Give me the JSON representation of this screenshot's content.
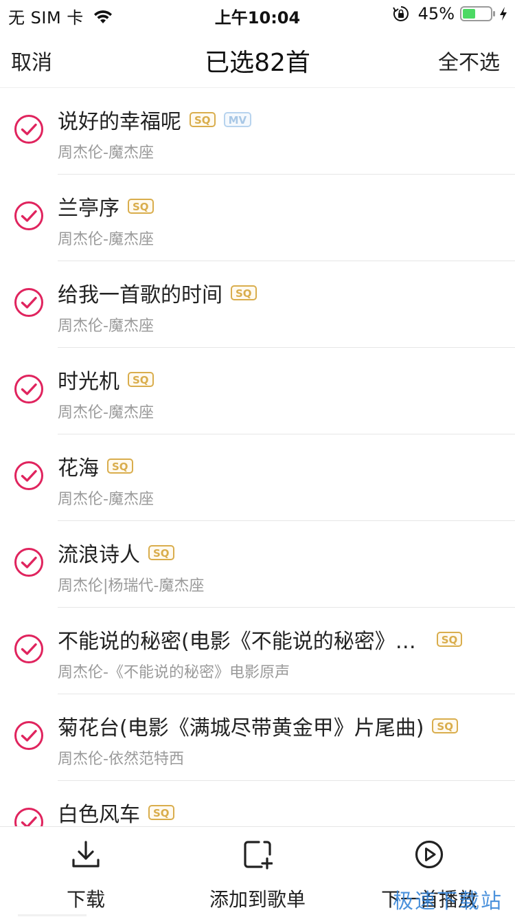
{
  "status_bar": {
    "carrier": "无 SIM 卡",
    "time": "上午10:04",
    "battery_percent": "45%",
    "battery_level": 0.45,
    "icons": [
      "wifi-icon",
      "rotation-lock-icon",
      "battery-icon",
      "charging-bolt-icon"
    ]
  },
  "nav": {
    "cancel_label": "取消",
    "title": "已选82首",
    "deselect_all_label": "全不选"
  },
  "accent_color": "#e0245e",
  "badge_colors": {
    "sq": "#d9ad4c",
    "mv": "#a9c8e6"
  },
  "songs": [
    {
      "title": "说好的幸福呢",
      "sq": "SQ",
      "mv": "MV",
      "subtitle": "周杰伦-魔杰座",
      "checked": true
    },
    {
      "title": "兰亭序",
      "sq": "SQ",
      "subtitle": "周杰伦-魔杰座",
      "checked": true
    },
    {
      "title": "给我一首歌的时间",
      "sq": "SQ",
      "subtitle": "周杰伦-魔杰座",
      "checked": true
    },
    {
      "title": "时光机",
      "sq": "SQ",
      "subtitle": "周杰伦-魔杰座",
      "checked": true
    },
    {
      "title": "花海",
      "sq": "SQ",
      "subtitle": "周杰伦-魔杰座",
      "checked": true
    },
    {
      "title": "流浪诗人",
      "sq": "SQ",
      "subtitle": "周杰伦|杨瑞代-魔杰座",
      "checked": true
    },
    {
      "title": "不能说的秘密(电影《不能说的秘密》…",
      "sq": "SQ",
      "subtitle": "周杰伦-《不能说的秘密》电影原声",
      "checked": true
    },
    {
      "title": "菊花台(电影《满城尽带黄金甲》片尾曲)",
      "sq": "SQ",
      "subtitle": "周杰伦-依然范特西",
      "checked": true
    },
    {
      "title": "白色风车",
      "sq": "SQ",
      "subtitle": "",
      "checked": true
    }
  ],
  "toolbar": {
    "download_label": "下载",
    "add_to_playlist_label": "添加到歌单",
    "play_next_label": "下一首播放"
  },
  "watermark": "极速下载站"
}
